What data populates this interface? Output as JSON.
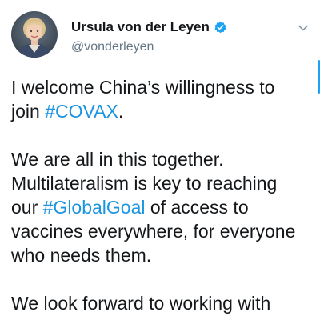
{
  "author": {
    "display_name": "Ursula von der Leyen",
    "handle": "@vonderleyen",
    "verified": true,
    "avatar": "avatar-photo"
  },
  "icons": {
    "verified": "verified-badge-icon",
    "menu": "chevron-down-icon"
  },
  "tweet": {
    "p1_a": "I welcome China’s willingness to join ",
    "p1_tag": "#COVAX",
    "p1_b": ".",
    "p2_a": "We are all in this together.",
    "p2_b": "Multilateralism is key to reaching our ",
    "p2_tag": "#GlobalGoal",
    "p2_c": " of access to vaccines everywhere, for everyone who needs them.",
    "p3_a": "We look forward to working with"
  },
  "colors": {
    "hashtag": "#1b95e0",
    "verified": "#1da1f2",
    "text": "#14171a",
    "secondary": "#657786"
  }
}
